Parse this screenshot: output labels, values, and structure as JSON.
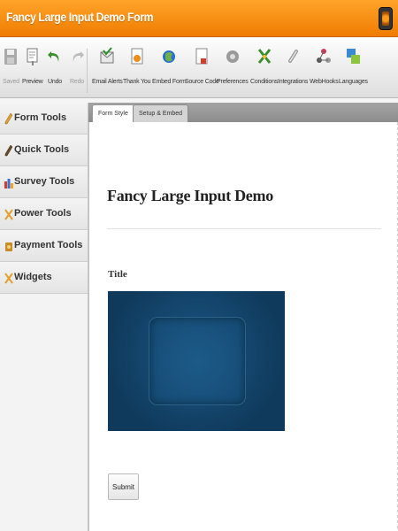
{
  "window": {
    "title": "Fancy Large Input Demo Form"
  },
  "toolbar": {
    "items": [
      {
        "label": "Saved",
        "icon": "save-icon",
        "enabled": false
      },
      {
        "label": "Preview",
        "icon": "preview-icon",
        "enabled": true
      },
      {
        "label": "Undo",
        "icon": "undo-icon",
        "enabled": true
      },
      {
        "label": "Redo",
        "icon": "redo-icon",
        "enabled": false
      },
      {
        "label": "Email Alerts",
        "icon": "email-alerts-icon",
        "enabled": true
      },
      {
        "label": "Thank You",
        "icon": "thank-you-icon",
        "enabled": true
      },
      {
        "label": "Embed Form",
        "icon": "embed-form-icon",
        "enabled": true
      },
      {
        "label": "Source Code",
        "icon": "source-code-icon",
        "enabled": true
      },
      {
        "label": "Preferences",
        "icon": "preferences-icon",
        "enabled": true
      },
      {
        "label": "Conditions",
        "icon": "conditions-icon",
        "enabled": true
      },
      {
        "label": "Integrations",
        "icon": "integrations-icon",
        "enabled": true
      },
      {
        "label": "WebHooks",
        "icon": "webhooks-icon",
        "enabled": true
      },
      {
        "label": "Languages",
        "icon": "languages-icon",
        "enabled": true
      }
    ]
  },
  "sidebar": {
    "items": [
      {
        "label": "Form Tools",
        "icon": "pencil-icon"
      },
      {
        "label": "Quick Tools",
        "icon": "pencil-icon"
      },
      {
        "label": "Survey Tools",
        "icon": "bar-chart-icon"
      },
      {
        "label": "Power Tools",
        "icon": "tools-icon"
      },
      {
        "label": "Payment Tools",
        "icon": "money-icon"
      },
      {
        "label": "Widgets",
        "icon": "tools-icon"
      }
    ]
  },
  "tabs": [
    {
      "label": "Form Style",
      "active": true
    },
    {
      "label": "Setup & Embed",
      "active": false
    }
  ],
  "form": {
    "heading": "Fancy Large Input Demo",
    "field_label": "Title",
    "submit_label": "Submit"
  },
  "colors": {
    "title_bar": "#ef7c00",
    "image_field": "#0f3a5c"
  }
}
